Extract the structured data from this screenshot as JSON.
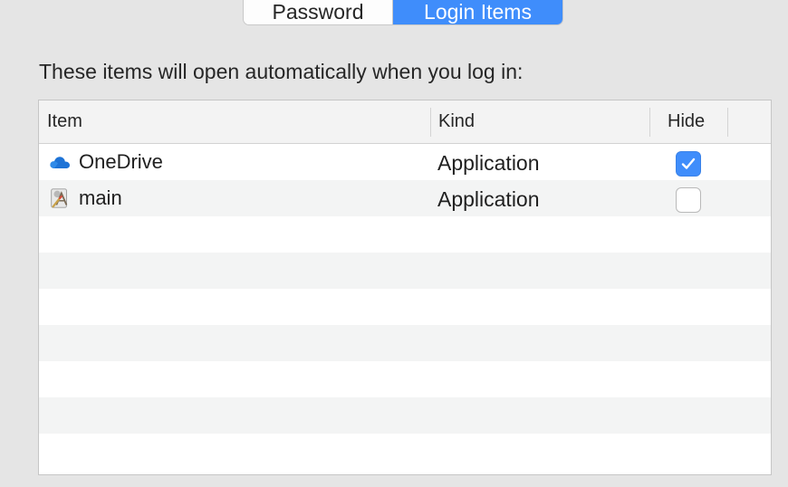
{
  "tabs": [
    {
      "label": "Password",
      "active": false
    },
    {
      "label": "Login Items",
      "active": true
    }
  ],
  "description": "These items will open automatically when you log in:",
  "table": {
    "columns": {
      "item": "Item",
      "kind": "Kind",
      "hide": "Hide"
    },
    "rows": [
      {
        "name": "OneDrive",
        "kind": "Application",
        "hide": true,
        "icon": "onedrive-cloud-icon"
      },
      {
        "name": "main",
        "kind": "Application",
        "hide": false,
        "icon": "script-app-icon"
      }
    ],
    "empty_rows": 7
  },
  "colors": {
    "accent": "#3f8dfb",
    "background": "#e5e5e5",
    "row_alt": "#f3f4f4"
  }
}
